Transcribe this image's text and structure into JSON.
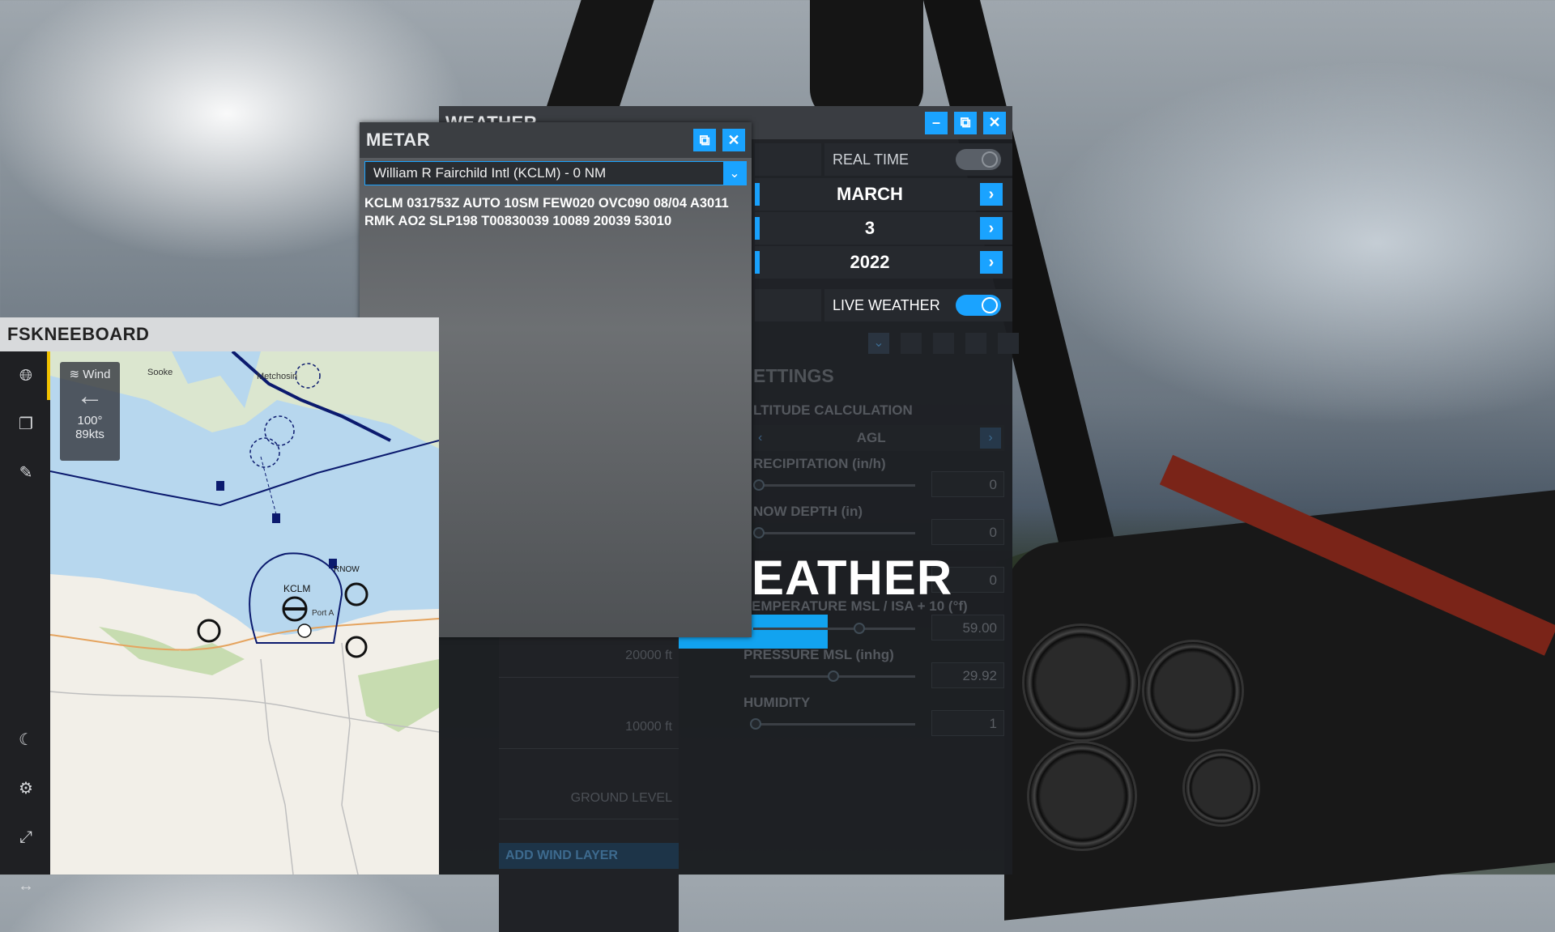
{
  "weather": {
    "title": "WEATHER",
    "real_time_label": "REAL TIME",
    "month": "MARCH",
    "day": "3",
    "year": "2022",
    "live_weather_label": "LIVE WEATHER",
    "settings_header": "ETTINGS",
    "altitude_calc_label": "LTITUDE CALCULATION",
    "altitude_mode": "AGL",
    "precipitation_label": "RECIPITATION (in/h)",
    "precipitation_value": "0",
    "snow_label": "NOW DEPTH (in)",
    "snow_value": "0",
    "lightning_value": "0",
    "overlay_banner": "EATHER",
    "temperature_label": "EMPERATURE MSL / ISA + 10 (°f)",
    "temperature_value": "59.00",
    "pressure_label": "PRESSURE MSL (inhg)",
    "pressure_value": "29.92",
    "humidity_label": "HUMIDITY",
    "humidity_value": "1",
    "layer_20000": "20000 ft",
    "layer_10000": "10000 ft",
    "layer_ground": "GROUND LEVEL",
    "add_wind_layer": "ADD WIND LAYER"
  },
  "metar": {
    "title": "METAR",
    "station_selected": "William R Fairchild Intl (KCLM) - 0 NM",
    "report_line1": "KCLM 031753Z AUTO 10SM FEW020 OVC090 08/04 A3011",
    "report_line2": "RMK AO2 SLP198 T00830039 10089 20039 53010"
  },
  "fskneeboard": {
    "title": "FSKNEEBOARD",
    "wind_label": "Wind",
    "wind_dir": "100°",
    "wind_speed": "89kts",
    "map_labels": {
      "sooke": "Sooke",
      "metchosin": "Metchosin",
      "kclm": "KCLM",
      "port": "Port A",
      "rnow": "RNOW"
    }
  },
  "colors": {
    "accent": "#1aa3ff",
    "panel": "#1c1e22",
    "header": "#3a3d42"
  }
}
